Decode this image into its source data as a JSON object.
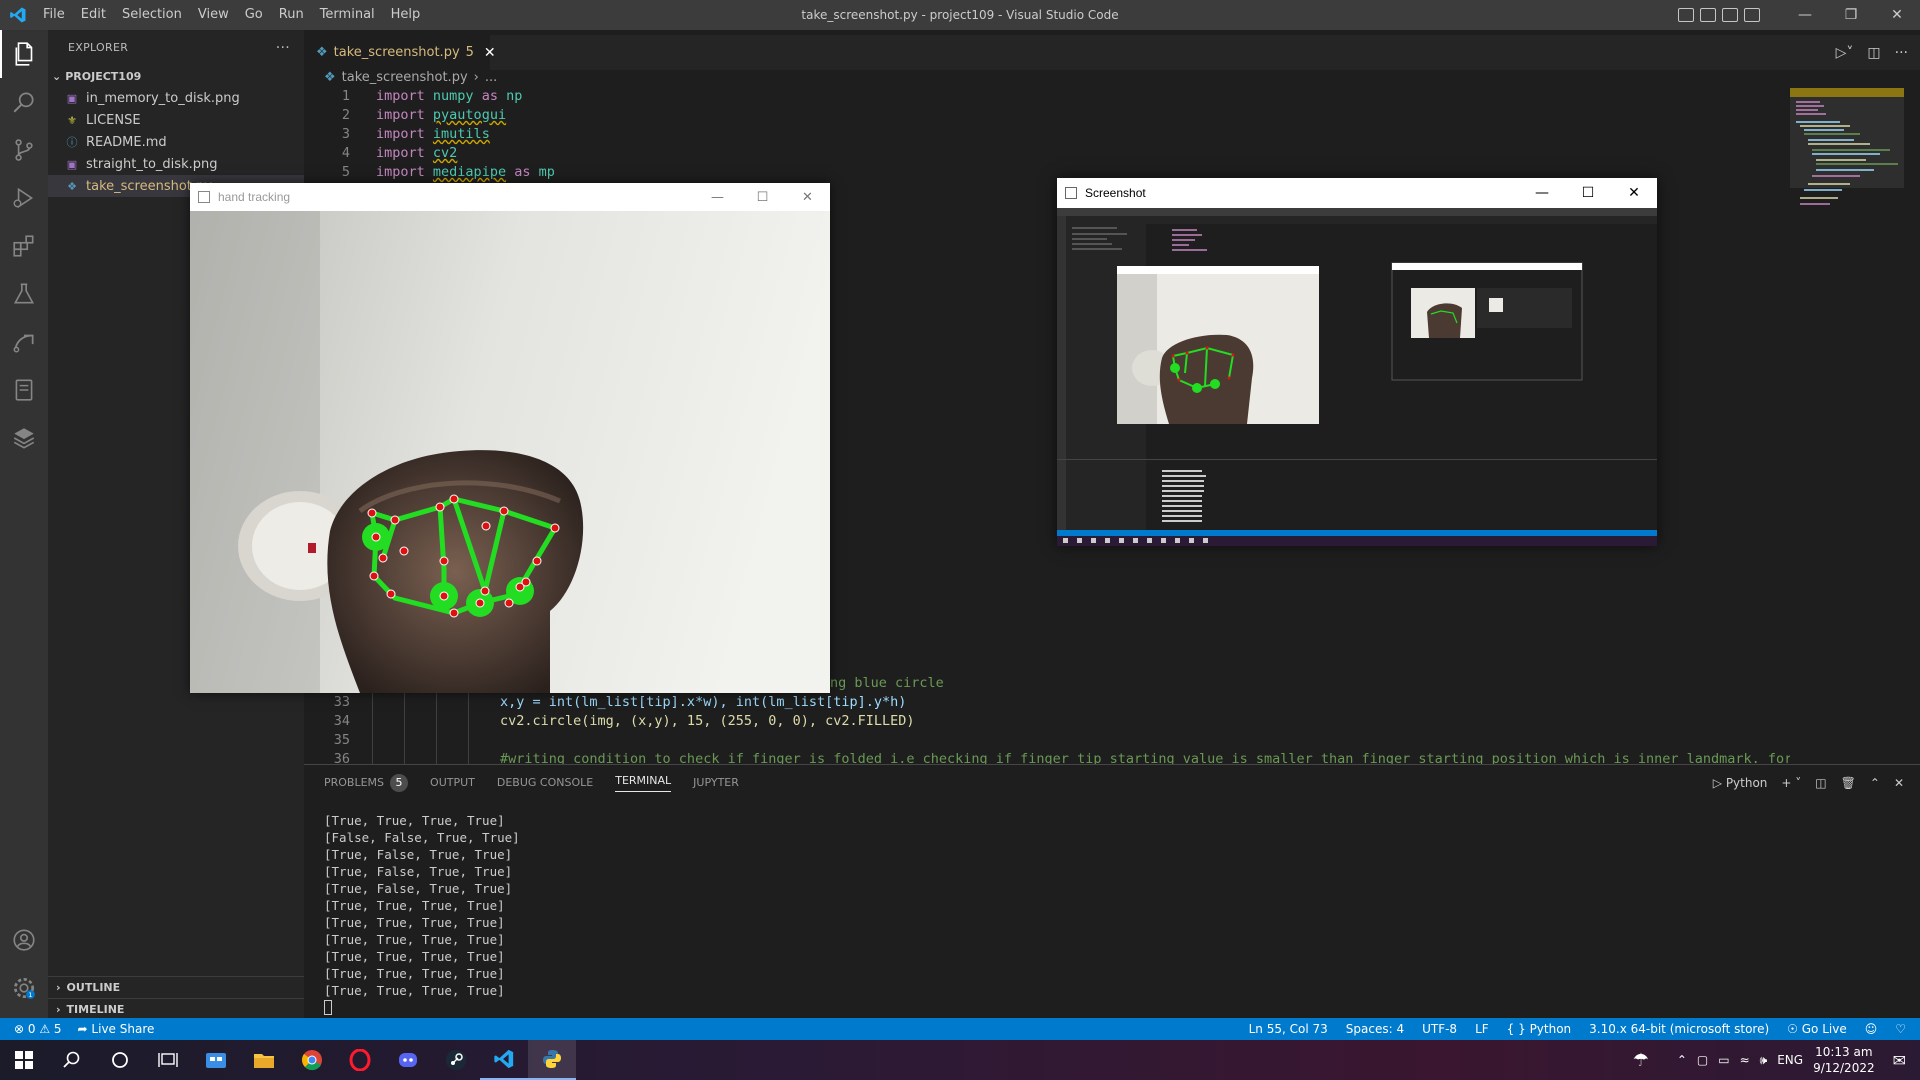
{
  "menu": [
    "File",
    "Edit",
    "Selection",
    "View",
    "Go",
    "Run",
    "Terminal",
    "Help"
  ],
  "window_title": "take_screenshot.py - project109 - Visual Studio Code",
  "sidebar": {
    "header": "EXPLORER",
    "project": "PROJECT109",
    "files": [
      {
        "name": "in_memory_to_disk.png",
        "icon": "image-icon"
      },
      {
        "name": "LICENSE",
        "icon": "license-icon"
      },
      {
        "name": "README.md",
        "icon": "info-icon"
      },
      {
        "name": "straight_to_disk.png",
        "icon": "image-icon"
      },
      {
        "name": "take_screenshot.py",
        "icon": "python-icon"
      }
    ],
    "outline": "OUTLINE",
    "timeline": "TIMELINE"
  },
  "tab": {
    "name": "take_screenshot.py",
    "count": "5"
  },
  "breadcrumb": {
    "file": "take_screenshot.py",
    "rest": "..."
  },
  "code_top": [
    {
      "n": "1",
      "kw": "import",
      "mod": "numpy",
      "as": "as",
      "alias": "np",
      "squig": false
    },
    {
      "n": "2",
      "kw": "import",
      "mod": "pyautogui",
      "as": "",
      "alias": "",
      "squig": true
    },
    {
      "n": "3",
      "kw": "import",
      "mod": "imutils",
      "as": "",
      "alias": "",
      "squig": true
    },
    {
      "n": "4",
      "kw": "import",
      "mod": "cv2",
      "as": "",
      "alias": "",
      "squig": true
    },
    {
      "n": "5",
      "kw": "import",
      "mod": "mediapipe",
      "as": "as",
      "alias": "mp",
      "squig": true
    }
  ],
  "code_bottom": {
    "partial_comment": "ng blue circle",
    "l33_num": "33",
    "l33_code": "x,y = int(lm_list[tip].x*w), int(lm_list[tip].y*h)",
    "l34_num": "34",
    "l34_code": "cv2.circle(img, (x,y), 15, (255, 0, 0), cv2.FILLED)",
    "l35_num": "35",
    "l36_num": "36",
    "l36_code": "#writing condition to check if finger is folded i.e checking if finger tip starting value is smaller than finger starting position which is inner landmark. for index fi"
  },
  "panel": {
    "tabs": [
      "PROBLEMS",
      "OUTPUT",
      "DEBUG CONSOLE",
      "TERMINAL",
      "JUPYTER"
    ],
    "problems_count": "5",
    "active": "TERMINAL",
    "shell": "Python",
    "terminal_lines": [
      "[True, True, True, True]",
      "[False, False, True, True]",
      "[True, False, True, True]",
      "[True, False, True, True]",
      "[True, False, True, True]",
      "[True, True, True, True]",
      "[True, True, True, True]",
      "[True, True, True, True]",
      "[True, True, True, True]",
      "[True, True, True, True]",
      "[True, True, True, True]"
    ]
  },
  "status": {
    "errors": "0",
    "warnings": "5",
    "live_share": "Live Share",
    "position": "Ln 55, Col 73",
    "spaces": "Spaces: 4",
    "encoding": "UTF-8",
    "eol": "LF",
    "language": "Python",
    "interpreter": "3.10.x 64-bit (microsoft store)",
    "go_live": "Go Live"
  },
  "hand_window": {
    "title": "hand tracking"
  },
  "screenshot_window": {
    "title": "Screenshot"
  },
  "taskbar": {
    "lang": "ENG",
    "time": "10:13 am",
    "date": "9/12/2022"
  },
  "colors": {
    "accent": "#007acc",
    "landmark_line": "#22dd22",
    "landmark_dot": "#dd1111"
  }
}
